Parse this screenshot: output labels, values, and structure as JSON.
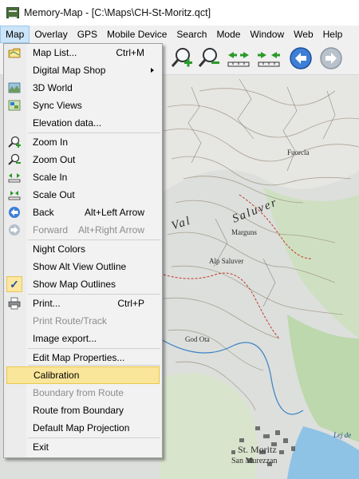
{
  "window": {
    "title": "Memory-Map - [C:\\Maps\\CH-St-Moritz.qct]"
  },
  "menubar": {
    "items": [
      "Map",
      "Overlay",
      "GPS",
      "Mobile Device",
      "Search",
      "Mode",
      "Window",
      "Web",
      "Help"
    ],
    "active": "Map"
  },
  "map_menu": {
    "items": [
      {
        "label": "Map List...",
        "shortcut": "Ctrl+M",
        "icon": "map-list-icon"
      },
      {
        "label": "Digital Map Shop",
        "submenu": true
      },
      {
        "label": "3D World",
        "icon": "3d-world-icon"
      },
      {
        "label": "Sync Views",
        "icon": "sync-views-icon"
      },
      {
        "label": "Elevation data..."
      },
      {
        "label": "Zoom In",
        "icon": "zoom-in-icon"
      },
      {
        "label": "Zoom Out",
        "icon": "zoom-out-icon"
      },
      {
        "label": "Scale In",
        "icon": "scale-in-icon"
      },
      {
        "label": "Scale Out",
        "icon": "scale-out-icon"
      },
      {
        "label": "Back",
        "shortcut": "Alt+Left Arrow",
        "icon": "back-icon"
      },
      {
        "label": "Forward",
        "shortcut": "Alt+Right Arrow",
        "icon": "forward-icon",
        "disabled": true
      },
      {
        "label": "Night Colors"
      },
      {
        "label": "Show Alt View Outline"
      },
      {
        "label": "Show Map Outlines",
        "checked": true
      },
      {
        "label": "Print...",
        "shortcut": "Ctrl+P",
        "icon": "print-icon"
      },
      {
        "label": "Print Route/Track",
        "disabled": true
      },
      {
        "label": "Image export..."
      },
      {
        "label": "Edit Map Properties..."
      },
      {
        "label": "Calibration",
        "highlighted": true
      },
      {
        "label": "Boundary from Route",
        "disabled": true
      },
      {
        "label": "Route from Boundary"
      },
      {
        "label": "Default Map Projection"
      },
      {
        "label": "Exit"
      }
    ]
  },
  "toolbar": {
    "buttons": [
      "zoom-in-icon",
      "zoom-out-icon",
      "scale-in-icon",
      "scale-out-icon",
      "back-icon",
      "forward-icon"
    ]
  },
  "map_labels": {
    "val": "Val",
    "saluver": "Saluver",
    "st_moritz": "St. Moritz",
    "san_murezzan": "San Murezzan",
    "fuorcla": "Fuorcla",
    "lej": "Lej de",
    "god_ota": "God Ota",
    "marguns": "Marguns",
    "alp": "Alp Saluver"
  },
  "colors": {
    "menu_highlight": "#fae69a",
    "menubar_active": "#cce4f7",
    "nav_button_blue": "#3d7fd6"
  }
}
